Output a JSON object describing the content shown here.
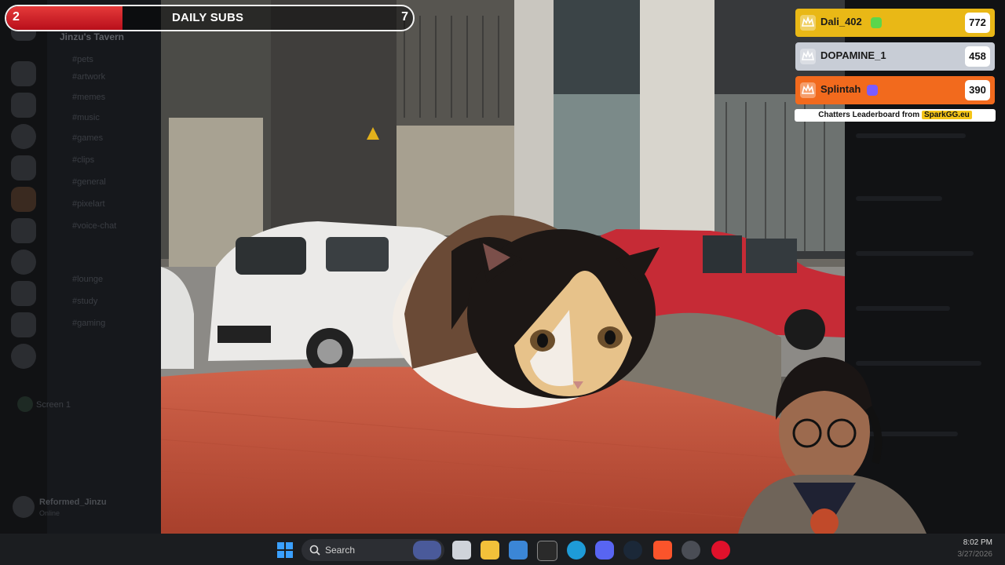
{
  "overlay": {
    "daily_subs": {
      "title": "DAILY SUBS",
      "current": "2",
      "goal": "7",
      "progress": 0.2857
    }
  },
  "leaderboard": {
    "entries": [
      {
        "name": "Dali_402",
        "score": "772",
        "color": "#e9b816",
        "text_color": "#1a1a1a",
        "badge_color": "#5bd64b"
      },
      {
        "name": "DOPAMINE_1",
        "score": "458",
        "color": "#c8cdd6",
        "text_color": "#1a1a1a",
        "badge_color": ""
      },
      {
        "name": "Splintah",
        "score": "390",
        "color": "#f26a1d",
        "text_color": "#1a1a1a",
        "badge_color": "#7b5cff"
      }
    ],
    "footer_text": "Chatters Leaderboard from",
    "footer_brand": "SparkGG.eu"
  },
  "discord": {
    "server_name": "Jinzu's Tavern",
    "channels": [
      "#pets",
      "#artwork",
      "#memes",
      "#music",
      "#games",
      "#clips",
      "#general",
      "#pixelart",
      "#voice-chat",
      "#lounge",
      "#study",
      "#gaming"
    ],
    "voice_channel": "Screen 1",
    "user": {
      "name": "Reformed_Jinzu",
      "status": "Online"
    }
  },
  "taskbar": {
    "search_placeholder": "Search",
    "clock": "8:02 PM",
    "date": "3/27/2026",
    "icons": [
      "start-icon",
      "search-icon",
      "widget-icon",
      "task-view-icon",
      "file-explorer-icon",
      "store-icon",
      "obs-icon",
      "edge-icon",
      "discord-icon",
      "steam-icon",
      "brave-icon",
      "chrome-icon",
      "opera-icon"
    ]
  }
}
